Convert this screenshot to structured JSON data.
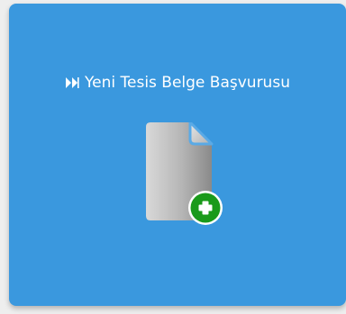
{
  "tile": {
    "title": "Yeni Tesis Belge Başvurusu",
    "title_icon": "double-chevron-right-icon",
    "main_icon": "document-add-icon"
  },
  "colors": {
    "tile_background": "#3a98de",
    "text": "#ffffff",
    "document": "#b8b8b8",
    "add_badge": "#1a9a1a"
  }
}
